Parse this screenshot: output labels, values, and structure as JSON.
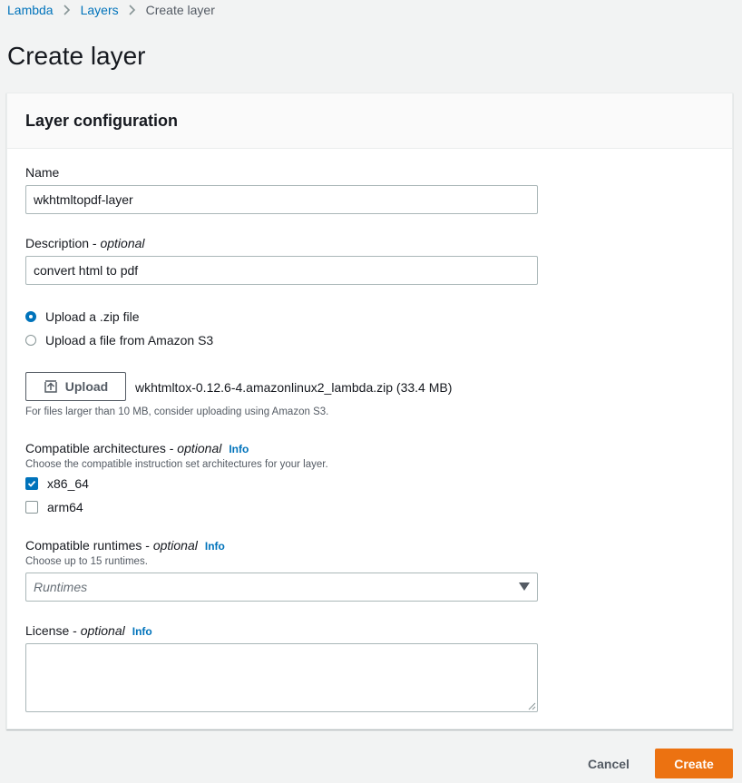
{
  "breadcrumb": {
    "items": [
      "Lambda",
      "Layers"
    ],
    "current": "Create layer"
  },
  "page_title": "Create layer",
  "card": {
    "header": "Layer configuration"
  },
  "name_field": {
    "label": "Name",
    "value": "wkhtmltopdf-layer"
  },
  "description_field": {
    "label": "Description - ",
    "optional": "optional",
    "value": "convert html to pdf"
  },
  "source_options": {
    "items": [
      {
        "label": "Upload a .zip file",
        "selected": true
      },
      {
        "label": "Upload a file from Amazon S3",
        "selected": false
      }
    ]
  },
  "upload": {
    "button_label": "Upload",
    "file_name": "wkhtmltox-0.12.6-4.amazonlinux2_lambda.zip (33.4 MB)",
    "hint": "For files larger than 10 MB, consider uploading using Amazon S3."
  },
  "architectures": {
    "label": "Compatible architectures - ",
    "optional": "optional",
    "info": "Info",
    "hint": "Choose the compatible instruction set architectures for your layer.",
    "options": [
      {
        "label": "x86_64",
        "checked": true
      },
      {
        "label": "arm64",
        "checked": false
      }
    ]
  },
  "runtimes": {
    "label": "Compatible runtimes - ",
    "optional": "optional",
    "info": "Info",
    "hint": "Choose up to 15 runtimes.",
    "placeholder": "Runtimes"
  },
  "license": {
    "label": "License - ",
    "optional": "optional",
    "info": "Info",
    "value": ""
  },
  "actions": {
    "cancel": "Cancel",
    "create": "Create"
  },
  "colors": {
    "link": "#0073bb",
    "primary_button": "#ec7211",
    "background": "#f2f3f3"
  },
  "icons": {
    "breadcrumb_separator": "chevron-right-icon",
    "upload": "upload-icon",
    "select": "caret-down-icon",
    "checkbox": "check-icon"
  }
}
